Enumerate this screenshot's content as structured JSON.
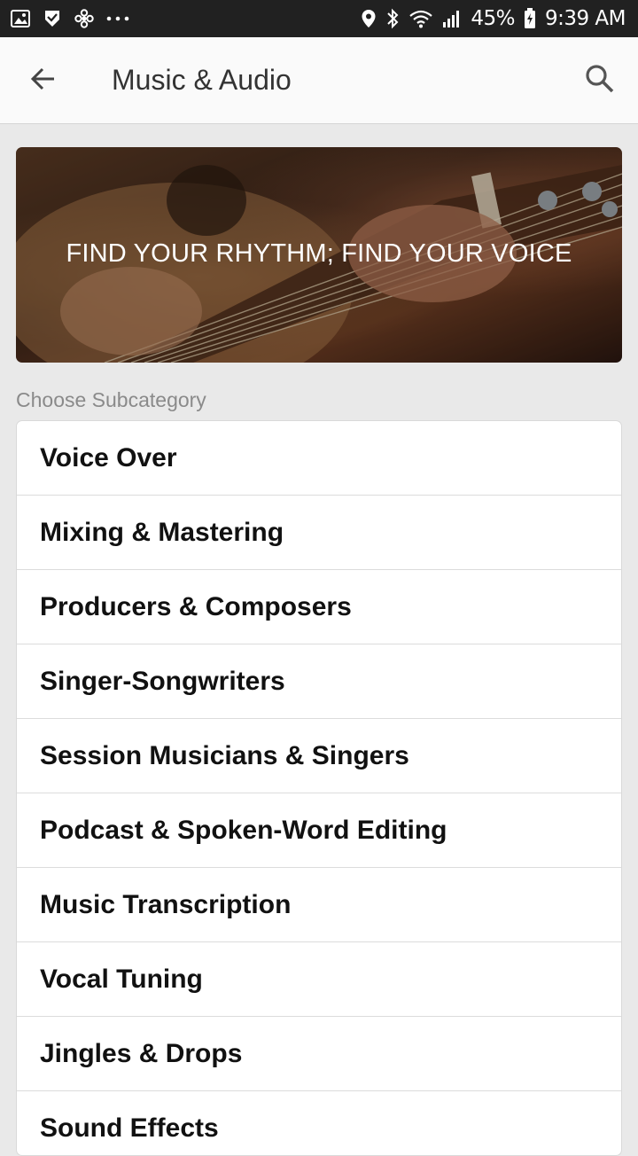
{
  "status_bar": {
    "battery_percent": "45%",
    "time": "9:39 AM",
    "icons_left": [
      "image-icon",
      "download-check-icon",
      "fan-icon",
      "more-dots-icon"
    ],
    "icons_right": [
      "location-pin-icon",
      "bluetooth-icon",
      "wifi-icon",
      "signal-icon",
      "battery-icon"
    ]
  },
  "app_bar": {
    "title": "Music & Audio",
    "back_icon": "arrow-left-icon",
    "search_icon": "search-icon"
  },
  "hero": {
    "text": "FIND YOUR RHYTHM; FIND YOUR VOICE"
  },
  "section": {
    "label": "Choose Subcategory"
  },
  "subcategories": [
    {
      "label": "Voice Over"
    },
    {
      "label": "Mixing & Mastering"
    },
    {
      "label": "Producers & Composers"
    },
    {
      "label": "Singer-Songwriters"
    },
    {
      "label": "Session Musicians & Singers"
    },
    {
      "label": "Podcast & Spoken-Word Editing"
    },
    {
      "label": "Music Transcription"
    },
    {
      "label": "Vocal Tuning"
    },
    {
      "label": "Jingles & Drops"
    },
    {
      "label": "Sound Effects"
    }
  ],
  "colors": {
    "status_bar_bg": "#212121",
    "app_bar_bg": "#fafafa",
    "page_bg": "#e9e9e9",
    "list_bg": "#ffffff",
    "title_text": "#333333",
    "section_label_text": "#8a8a8a"
  }
}
